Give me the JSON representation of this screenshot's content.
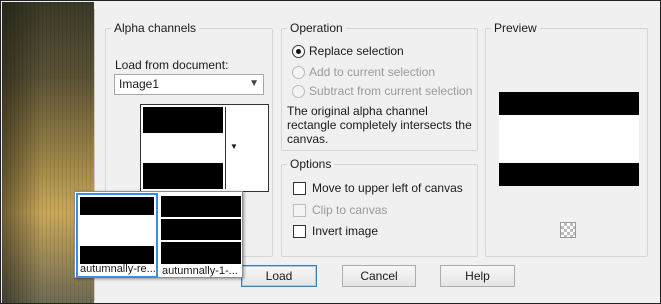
{
  "alpha_channels": {
    "title": "Alpha channels",
    "load_from_label": "Load from document:",
    "document_selected": "Image1"
  },
  "operation": {
    "title": "Operation",
    "options": [
      {
        "label": "Replace selection",
        "checked": true,
        "enabled": true
      },
      {
        "label": "Add to current selection",
        "checked": false,
        "enabled": false
      },
      {
        "label": "Subtract from current selection",
        "checked": false,
        "enabled": false
      }
    ],
    "message": "The original alpha channel rectangle completely intersects the canvas."
  },
  "options": {
    "title": "Options",
    "items": [
      {
        "label": "Move to upper left of canvas",
        "checked": false,
        "enabled": true
      },
      {
        "label": "Clip to canvas",
        "checked": false,
        "enabled": false
      },
      {
        "label": "Invert image",
        "checked": false,
        "enabled": true
      }
    ]
  },
  "preview": {
    "title": "Preview"
  },
  "channel_popup": {
    "items": [
      {
        "caption": "autumnally-re...",
        "selected": true
      },
      {
        "caption": "autumnally-1-..."
      }
    ]
  },
  "buttons": {
    "load": "Load",
    "cancel": "Cancel",
    "help": "Help"
  },
  "icons": {
    "dropdown": "chevron-down-icon",
    "transparency": "checkerboard-icon"
  }
}
